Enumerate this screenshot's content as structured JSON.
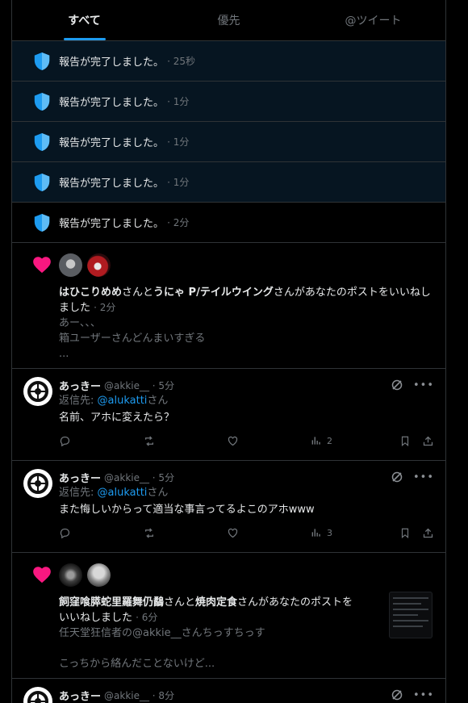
{
  "tabs": [
    {
      "label": "すべて",
      "active": true
    },
    {
      "label": "優先"
    },
    {
      "label": "@ツイート"
    }
  ],
  "reports": [
    {
      "text": "報告が完了しました。",
      "time": "· 25秒",
      "unread": true
    },
    {
      "text": "報告が完了しました。",
      "time": "· 1分",
      "unread": true
    },
    {
      "text": "報告が完了しました。",
      "time": "· 1分",
      "unread": true
    },
    {
      "text": "報告が完了しました。",
      "time": "· 1分",
      "unread": true
    },
    {
      "text": "報告が完了しました。",
      "time": "· 2分",
      "unread": false
    }
  ],
  "like1": {
    "name1": "はひこりめめ",
    "conj": "さんと",
    "name2": "うにゃ P/テイルウイング",
    "tail": "さんがあなたのポストをいいねしました",
    "time": "· 2分",
    "preview1": "あー、、、",
    "preview2": "箱ユーザーさんどんまいすぎる",
    "preview3": "..."
  },
  "posts": [
    {
      "name": "あっきー",
      "handle": "@akkie__ · 5分",
      "reply_prefix": "返信先: ",
      "reply_to": "@alukatti",
      "reply_suffix": "さん",
      "text": "名前、アホに変えたら？",
      "views": "2"
    },
    {
      "name": "あっきー",
      "handle": "@akkie__ · 5分",
      "reply_prefix": "返信先: ",
      "reply_to": "@alukatti",
      "reply_suffix": "さん",
      "text": "また悔しいからって適当な事言ってるよこのアホwww",
      "views": "3"
    }
  ],
  "like2": {
    "name1": "飼窪喰膵蛇里羅舞仍鷸",
    "conj": "さんと",
    "name2": "焼肉定食",
    "tail": "さんがあなたのポストをいいねしました",
    "time": "· 6分",
    "preview1": "任天堂狂信者の@akkie__さんちっすちっす",
    "preview2": "こっちから絡んだことないけど..."
  },
  "post3": {
    "name": "あっきー",
    "handle": "@akkie__ · 8分"
  },
  "colors": {
    "accent": "#1d9bf0",
    "like": "#f91880",
    "shield": "#1d9bf0"
  }
}
